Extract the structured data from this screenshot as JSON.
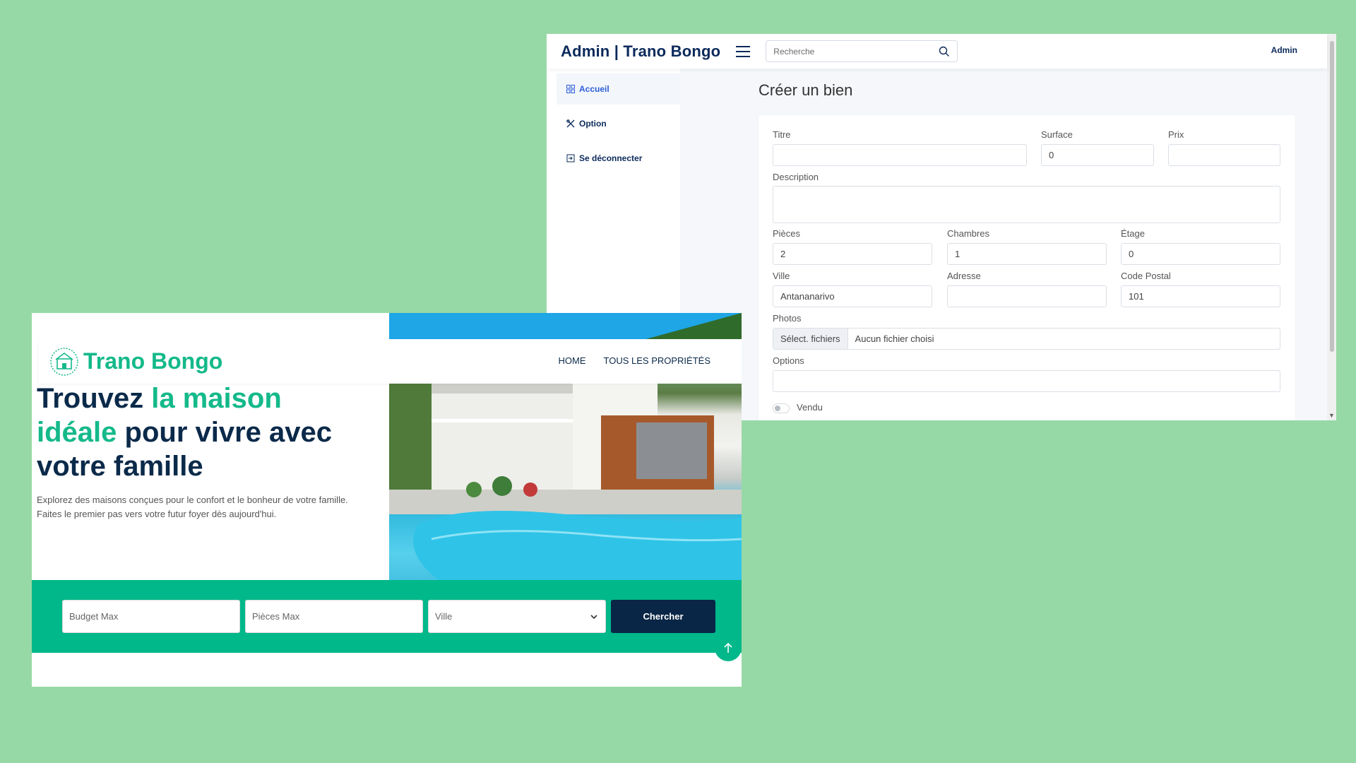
{
  "colors": {
    "background": "#97d9a6",
    "admin_navy": "#0b2a5b",
    "brand_green": "#14b98a",
    "band_green": "#00b88a",
    "button_navy": "#0a2646"
  },
  "admin": {
    "brand": "Admin | Trano Bongo",
    "search_placeholder": "Recherche",
    "user_label": "Admin",
    "sidebar": [
      {
        "label": "Accueil",
        "icon": "grid-icon",
        "active": true
      },
      {
        "label": "Option",
        "icon": "tools-icon",
        "active": false
      },
      {
        "label": "Se déconnecter",
        "icon": "logout-icon",
        "active": false
      }
    ],
    "page_title": "Créer un bien",
    "form": {
      "titre_label": "Titre",
      "titre_value": "",
      "surface_label": "Surface",
      "surface_value": "0",
      "prix_label": "Prix",
      "prix_value": "",
      "description_label": "Description",
      "description_value": "",
      "pieces_label": "Pièces",
      "pieces_value": "2",
      "chambres_label": "Chambres",
      "chambres_value": "1",
      "etage_label": "Étage",
      "etage_value": "0",
      "ville_label": "Ville",
      "ville_value": "Antananarivo",
      "adresse_label": "Adresse",
      "adresse_value": "",
      "code_postal_label": "Code Postal",
      "code_postal_value": "101",
      "photos_label": "Photos",
      "file_button": "Sélect. fichiers",
      "file_status": "Aucun fichier choisi",
      "options_label": "Options",
      "options_value": "",
      "vendu_label": "Vendu"
    }
  },
  "site": {
    "brand": "Trano Bongo",
    "nav": [
      "HOME",
      "TOUS LES PROPRIÉTÉS"
    ],
    "hero": {
      "line1_a": "Trouvez ",
      "line1_b": "la maison",
      "line2_a": "idéale",
      "line2_b": " pour vivre avec",
      "line3": "votre famille",
      "subtitle_1": "Explorez des maisons conçues pour le confort et le bonheur de votre famille.",
      "subtitle_2": "Faites le premier pas vers votre futur foyer dès aujourd'hui."
    },
    "search": {
      "budget_placeholder": "Budget Max",
      "pieces_placeholder": "Pièces Max",
      "ville_select": "Ville",
      "button": "Chercher"
    }
  }
}
